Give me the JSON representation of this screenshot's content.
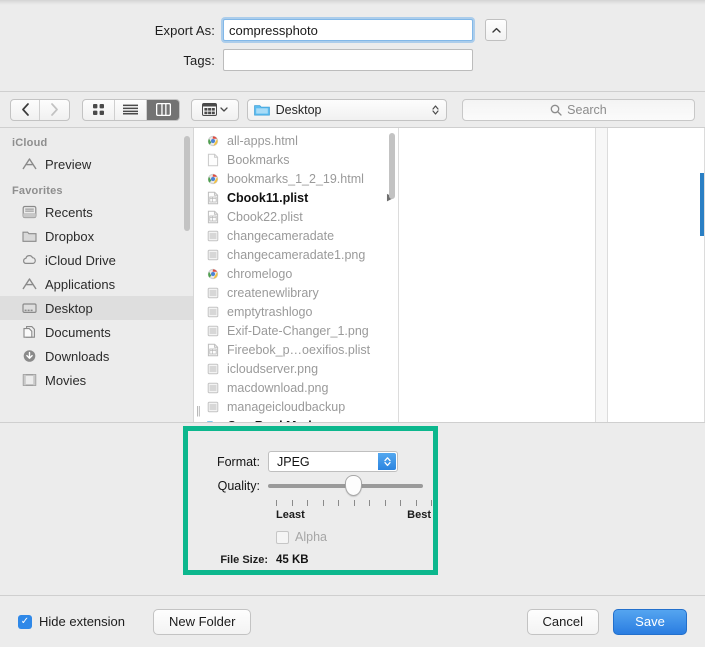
{
  "form": {
    "export_as_label": "Export As:",
    "export_as_value": "compressphoto",
    "tags_label": "Tags:",
    "tags_value": "",
    "tags_placeholder": "",
    "disclosure_icon": "chevron-up-icon"
  },
  "toolbar": {
    "back_icon": "chevron-left-icon",
    "forward_icon": "chevron-right-icon",
    "view_icon_grid": "icon-view-icon",
    "view_list": "list-view-icon",
    "view_column": "column-view-icon",
    "view_gallery": "gallery-view-icon",
    "action_icon": "action-menu-icon",
    "selected_view": "column",
    "path_label": "Desktop",
    "path_icon": "folder-icon",
    "path_chevrons_icon": "chevron-up-down-icon",
    "search_placeholder": "Search",
    "search_value": "",
    "search_icon": "search-icon"
  },
  "sidebar": {
    "groups": [
      {
        "title": "iCloud",
        "items": [
          {
            "label": "Preview",
            "icon": "applications-icon",
            "selected": false
          }
        ]
      },
      {
        "title": "Favorites",
        "items": [
          {
            "label": "Recents",
            "icon": "recents-icon",
            "selected": false
          },
          {
            "label": "Dropbox",
            "icon": "folder-icon",
            "selected": false
          },
          {
            "label": "iCloud Drive",
            "icon": "cloud-icon",
            "selected": false
          },
          {
            "label": "Applications",
            "icon": "applications-icon",
            "selected": false
          },
          {
            "label": "Desktop",
            "icon": "desktop-icon",
            "selected": true
          },
          {
            "label": "Documents",
            "icon": "documents-icon",
            "selected": false
          },
          {
            "label": "Downloads",
            "icon": "download-icon",
            "selected": false
          },
          {
            "label": "Movies",
            "icon": "movies-icon",
            "selected": false
          }
        ]
      }
    ]
  },
  "browser": {
    "files": [
      {
        "name": "all-apps.html",
        "icon": "chrome-doc-icon",
        "bold": false,
        "arrow": false
      },
      {
        "name": "Bookmarks",
        "icon": "blank-doc-icon",
        "bold": false,
        "arrow": false
      },
      {
        "name": "bookmarks_1_2_19.html",
        "icon": "chrome-doc-icon",
        "bold": false,
        "arrow": false
      },
      {
        "name": "Cbook11.plist",
        "icon": "plist-doc-icon",
        "bold": true,
        "arrow": true
      },
      {
        "name": "Cbook22.plist",
        "icon": "plist-doc-icon",
        "bold": false,
        "arrow": false
      },
      {
        "name": "changecameradate",
        "icon": "image-doc-icon",
        "bold": false,
        "arrow": false
      },
      {
        "name": "changecameradate1.png",
        "icon": "image-doc-icon",
        "bold": false,
        "arrow": false
      },
      {
        "name": "chromelogo",
        "icon": "chrome-doc-icon",
        "bold": false,
        "arrow": false
      },
      {
        "name": "createnewlibrary",
        "icon": "image-doc-icon",
        "bold": false,
        "arrow": false
      },
      {
        "name": "emptytrashlogo",
        "icon": "image-doc-icon",
        "bold": false,
        "arrow": false
      },
      {
        "name": "Exif-Date-Changer_1.png",
        "icon": "image-doc-icon",
        "bold": false,
        "arrow": false
      },
      {
        "name": "Fireebok_p…oexifios.plist",
        "icon": "plist-doc-icon",
        "bold": false,
        "arrow": false
      },
      {
        "name": "icloudserver.png",
        "icon": "image-doc-icon",
        "bold": false,
        "arrow": false
      },
      {
        "name": "macdownload.png",
        "icon": "image-doc-icon",
        "bold": false,
        "arrow": false
      },
      {
        "name": "manageicloudbackup",
        "icon": "image-doc-icon",
        "bold": false,
        "arrow": false
      },
      {
        "name": "One BookMark",
        "icon": "folder-blue-icon",
        "bold": true,
        "arrow": true
      }
    ]
  },
  "options": {
    "highlight_color": "#0cb78d",
    "format_label": "Format:",
    "format_value": "JPEG",
    "quality_label": "Quality:",
    "quality_least_label": "Least",
    "quality_best_label": "Best",
    "quality_tick_count": 11,
    "quality_position_percent": 55,
    "alpha_label": "Alpha",
    "alpha_checked": false,
    "alpha_enabled": false,
    "file_size_label": "File Size:",
    "file_size_value": "45 KB"
  },
  "footer": {
    "hide_extension_label": "Hide extension",
    "hide_extension_checked": true,
    "check_glyph": "✓",
    "new_folder_label": "New Folder",
    "cancel_label": "Cancel",
    "save_label": "Save"
  }
}
